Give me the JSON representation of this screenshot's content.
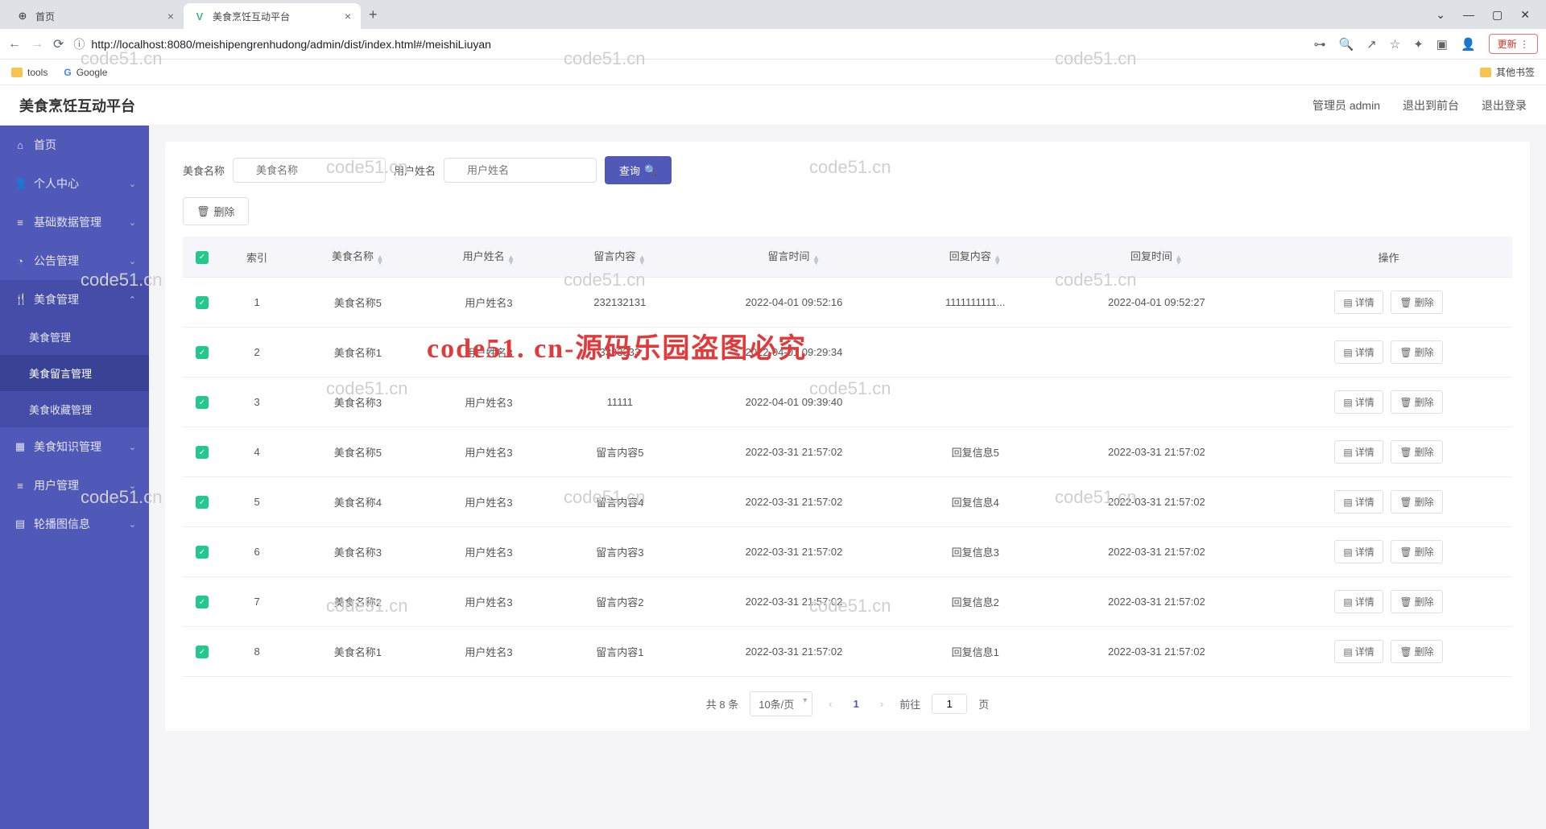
{
  "browser": {
    "tabs": [
      {
        "title": "首页",
        "favicon": "⊕"
      },
      {
        "title": "美食烹饪互动平台",
        "favicon": "V"
      }
    ],
    "new_tab": "+",
    "url": "http://localhost:8080/meishipengrenhudong/admin/dist/index.html#/meishiLiuyan",
    "update": "更新",
    "bookmarks": {
      "tools": "tools",
      "google": "Google",
      "other": "其他书签"
    }
  },
  "header": {
    "title": "美食烹饪互动平台",
    "user": "管理员 admin",
    "front": "退出到前台",
    "logout": "退出登录"
  },
  "sidebar": {
    "items": [
      {
        "icon": "⌂",
        "label": "首页"
      },
      {
        "icon": "👤",
        "label": "个人中心",
        "chev": "⌄"
      },
      {
        "icon": "≡",
        "label": "基础数据管理",
        "chev": "⌄"
      },
      {
        "icon": "◔",
        "label": "公告管理",
        "chev": "⌄"
      },
      {
        "icon": "🍴",
        "label": "美食管理",
        "chev": "⌃",
        "open": true,
        "subs": [
          "美食管理",
          "美食留言管理",
          "美食收藏管理"
        ]
      },
      {
        "icon": "▦",
        "label": "美食知识管理",
        "chev": "⌄"
      },
      {
        "icon": "≡",
        "label": "用户管理",
        "chev": "⌄"
      },
      {
        "icon": "▤",
        "label": "轮播图信息",
        "chev": "⌄"
      }
    ]
  },
  "filter": {
    "name_label": "美食名称",
    "name_placeholder": "美食名称",
    "user_label": "用户姓名",
    "user_placeholder": "用户姓名",
    "query": "查询",
    "delete": "删除"
  },
  "table": {
    "headers": [
      "索引",
      "美食名称",
      "用户姓名",
      "留言内容",
      "留言时间",
      "回复内容",
      "回复时间",
      "操作"
    ],
    "detail": "详情",
    "del": "删除",
    "rows": [
      {
        "idx": "1",
        "name": "美食名称5",
        "user": "用户姓名3",
        "msg": "232132131",
        "mtime": "2022-04-01 09:52:16",
        "reply": "1111111111...",
        "rtime": "2022-04-01 09:52:27"
      },
      {
        "idx": "2",
        "name": "美食名称1",
        "user": "用户姓名3",
        "msg": "3333333",
        "mtime": "2022-04-01 09:29:34",
        "reply": "",
        "rtime": ""
      },
      {
        "idx": "3",
        "name": "美食名称3",
        "user": "用户姓名3",
        "msg": "11111",
        "mtime": "2022-04-01 09:39:40",
        "reply": "",
        "rtime": ""
      },
      {
        "idx": "4",
        "name": "美食名称5",
        "user": "用户姓名3",
        "msg": "留言内容5",
        "mtime": "2022-03-31 21:57:02",
        "reply": "回复信息5",
        "rtime": "2022-03-31 21:57:02"
      },
      {
        "idx": "5",
        "name": "美食名称4",
        "user": "用户姓名3",
        "msg": "留言内容4",
        "mtime": "2022-03-31 21:57:02",
        "reply": "回复信息4",
        "rtime": "2022-03-31 21:57:02"
      },
      {
        "idx": "6",
        "name": "美食名称3",
        "user": "用户姓名3",
        "msg": "留言内容3",
        "mtime": "2022-03-31 21:57:02",
        "reply": "回复信息3",
        "rtime": "2022-03-31 21:57:02"
      },
      {
        "idx": "7",
        "name": "美食名称2",
        "user": "用户姓名3",
        "msg": "留言内容2",
        "mtime": "2022-03-31 21:57:02",
        "reply": "回复信息2",
        "rtime": "2022-03-31 21:57:02"
      },
      {
        "idx": "8",
        "name": "美食名称1",
        "user": "用户姓名3",
        "msg": "留言内容1",
        "mtime": "2022-03-31 21:57:02",
        "reply": "回复信息1",
        "rtime": "2022-03-31 21:57:02"
      }
    ]
  },
  "pagination": {
    "total": "共 8 条",
    "per_page": "10条/页",
    "current": "1",
    "goto_prefix": "前往",
    "goto_value": "1",
    "goto_suffix": "页"
  },
  "watermarks": {
    "text": "code51.cn",
    "big": "code51. cn-源码乐园盗图必究"
  }
}
